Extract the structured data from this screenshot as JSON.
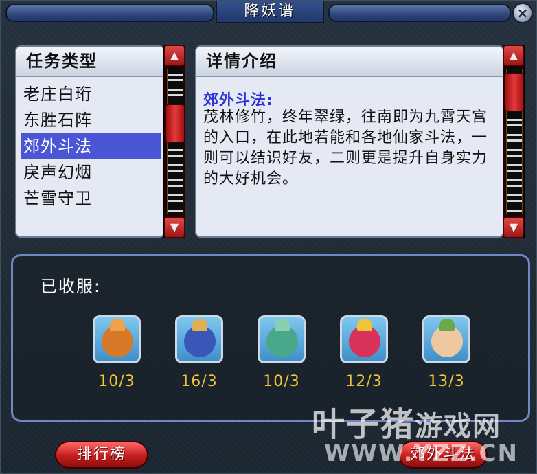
{
  "window": {
    "title": "降妖谱",
    "close_label": "×"
  },
  "task_panel": {
    "header": "任务类型",
    "items": [
      "老庄白珩",
      "东胜石阵",
      "郊外斗法",
      "戾声幻烟",
      "芒雪守卫"
    ],
    "selected": "郊外斗法"
  },
  "detail_panel": {
    "header": "详情介绍",
    "title": "郊外斗法:",
    "body": "茂林修竹，终年翠绿，往南即为九霄天宫的入口，在此地若能和各地仙家斗法，一则可以结识好友，二则更是提升自身实力的大好机会。"
  },
  "captured": {
    "label": "已收服:",
    "monsters": [
      {
        "count": "10/3",
        "icon": "orange-beast-icon",
        "color": "#d67a2a"
      },
      {
        "count": "16/3",
        "icon": "blue-armor-warrior-icon",
        "color": "#3a57b8"
      },
      {
        "count": "10/3",
        "icon": "teal-dragon-icon",
        "color": "#4aa88a"
      },
      {
        "count": "12/3",
        "icon": "red-bird-icon",
        "color": "#d8325a"
      },
      {
        "count": "13/3",
        "icon": "green-hair-girl-icon",
        "color": "#6aa84a"
      }
    ]
  },
  "buttons": {
    "rank": "排行榜",
    "action": "郊外斗法"
  },
  "watermark": {
    "line1": "叶子猪",
    "line1b": "游戏网",
    "line2": "WWW.YZZ.CN"
  }
}
